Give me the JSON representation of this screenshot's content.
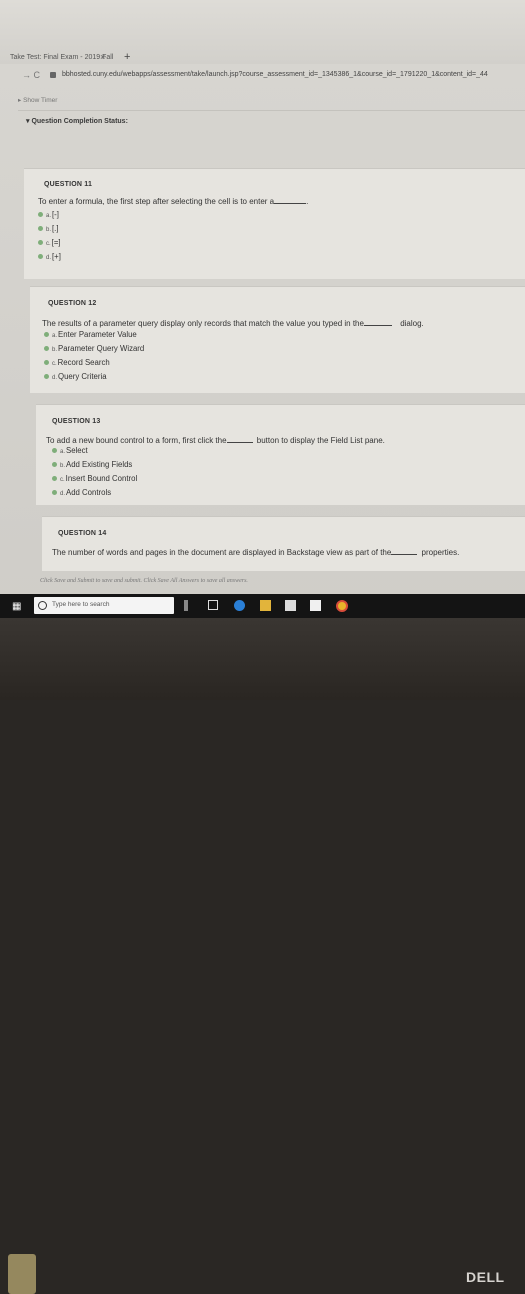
{
  "browser": {
    "tab_title": "Take Test: Final Exam - 2019 Fall",
    "tab_close": "×",
    "new_tab": "+",
    "back": "→ C",
    "url": "bbhosted.cuny.edu/webapps/assessment/take/launch.jsp?course_assessment_id=_1345386_1&course_id=_1791220_1&content_id=_44"
  },
  "page": {
    "show_timer": "▸ Show Timer",
    "question_status": "▾ Question Completion Status:",
    "save_hint": "Click Save and Submit to save and submit. Click Save All Answers to save all answers."
  },
  "questions": [
    {
      "number": "QUESTION 11",
      "text": "To enter a formula, the first step after selecting the cell is to enter a",
      "options": [
        {
          "letter": "a.",
          "label": "[-]"
        },
        {
          "letter": "b.",
          "label": "[.]"
        },
        {
          "letter": "c.",
          "label": "[=]"
        },
        {
          "letter": "d.",
          "label": "[+]"
        }
      ]
    },
    {
      "number": "QUESTION 12",
      "text": "The results of a parameter query display only records that match the value you typed in the",
      "text_after": "dialog.",
      "options": [
        {
          "letter": "a.",
          "label": "Enter Parameter Value"
        },
        {
          "letter": "b.",
          "label": "Parameter Query Wizard"
        },
        {
          "letter": "c.",
          "label": "Record Search"
        },
        {
          "letter": "d.",
          "label": "Query Criteria"
        }
      ]
    },
    {
      "number": "QUESTION 13",
      "text": "To add a new bound control to a form, first click the",
      "text_after": "button to display the Field List pane.",
      "options": [
        {
          "letter": "a.",
          "label": "Select"
        },
        {
          "letter": "b.",
          "label": "Add Existing Fields"
        },
        {
          "letter": "c.",
          "label": "Insert Bound Control"
        },
        {
          "letter": "d.",
          "label": "Add Controls"
        }
      ]
    },
    {
      "number": "QUESTION 14",
      "text": "The number of words and pages in the document are displayed in Backstage view as part of the",
      "text_after": "properties."
    }
  ],
  "taskbar": {
    "start_icon": "windows-logo",
    "search_placeholder": "Type here to search"
  },
  "device": {
    "brand": "DELL"
  }
}
